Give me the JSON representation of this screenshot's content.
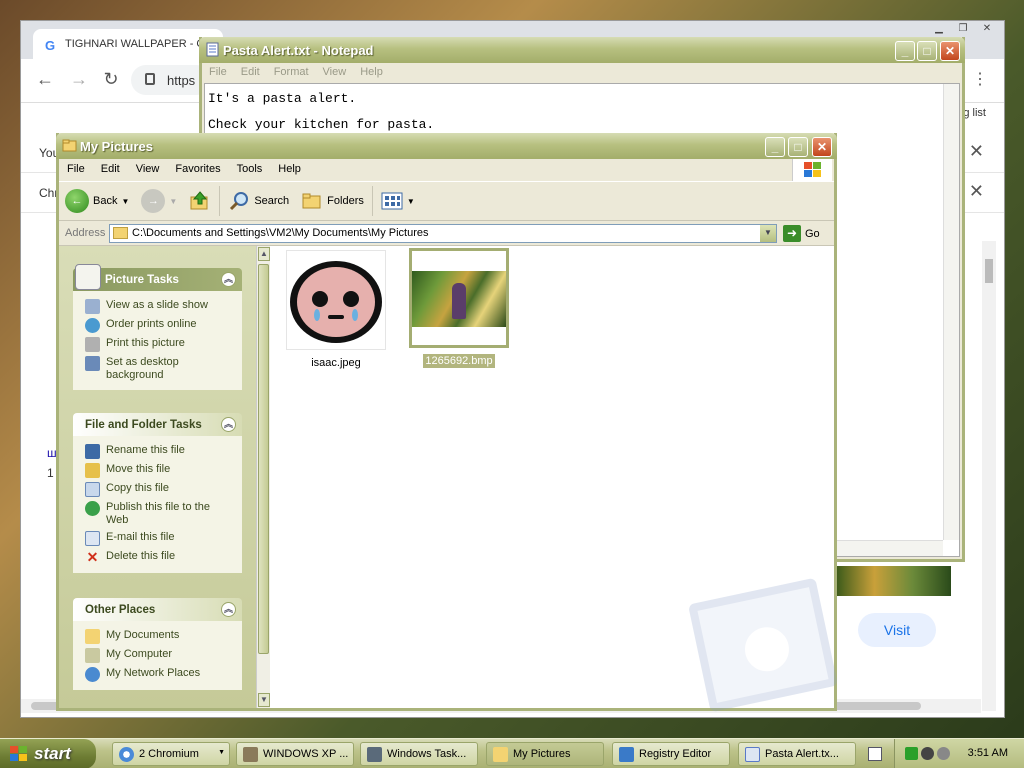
{
  "chromium": {
    "tab_title": "TIGHNARI WALLPAPER - G",
    "url_text": "https",
    "reading_list": "g list",
    "row1_text": "You",
    "row2_text": "Chr",
    "left_text_1": "ш",
    "left_text_2": "1",
    "visit_label": "Visit"
  },
  "notepad": {
    "title": "Pasta Alert.txt - Notepad",
    "menu": [
      "File",
      "Edit",
      "Format",
      "View",
      "Help"
    ],
    "content": "It's a pasta alert.\nCheck your kitchen for pasta."
  },
  "explorer": {
    "title": "My Pictures",
    "menu": [
      "File",
      "Edit",
      "View",
      "Favorites",
      "Tools",
      "Help"
    ],
    "toolbar": {
      "back": "Back",
      "search": "Search",
      "folders": "Folders"
    },
    "address_label": "Address",
    "address_value": "C:\\Documents and Settings\\VM2\\My Documents\\My Pictures",
    "go_label": "Go",
    "picture_tasks": {
      "title": "Picture Tasks",
      "items": [
        "View as a slide show",
        "Order prints online",
        "Print this picture",
        "Set as desktop background"
      ]
    },
    "file_tasks": {
      "title": "File and Folder Tasks",
      "items": [
        "Rename this file",
        "Move this file",
        "Copy this file",
        "Publish this file to the Web",
        "E-mail this file",
        "Delete this file"
      ]
    },
    "other_places": {
      "title": "Other Places",
      "items": [
        "My Documents",
        "My Computer",
        "My Network Places"
      ]
    },
    "files": [
      {
        "name": "isaac.jpeg",
        "selected": false
      },
      {
        "name": "1265692.bmp",
        "selected": true
      }
    ]
  },
  "taskbar": {
    "start": "start",
    "tasks": [
      {
        "label": "2 Chromium",
        "icon": "chromium-icon"
      },
      {
        "label": "WINDOWS XP ...",
        "icon": "spider-icon"
      },
      {
        "label": "Windows Task...",
        "icon": "taskmgr-icon"
      },
      {
        "label": "My Pictures",
        "icon": "folder-icon"
      },
      {
        "label": "Registry Editor",
        "icon": "regedit-icon"
      },
      {
        "label": "Pasta Alert.tx...",
        "icon": "notepad-icon"
      }
    ],
    "clock": "3:51 AM"
  }
}
